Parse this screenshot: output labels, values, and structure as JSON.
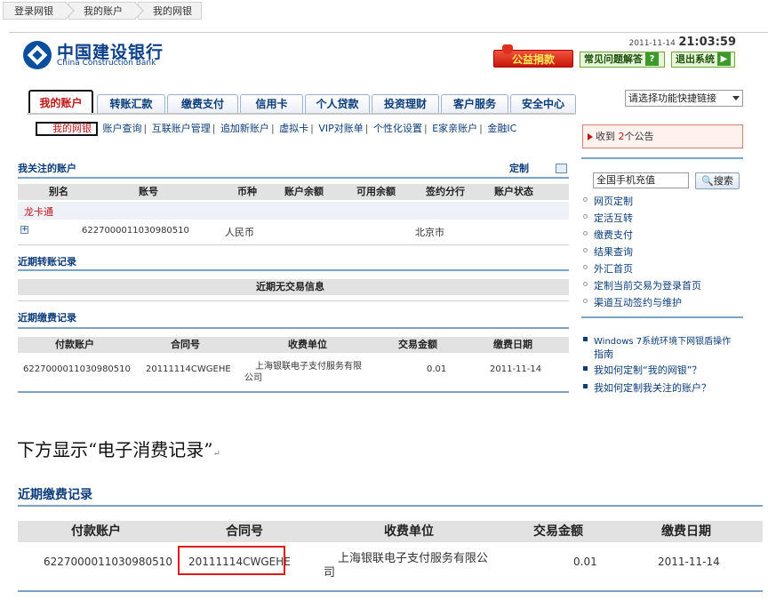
{
  "breadcrumb": [
    "登录网银",
    "我的账户",
    "我的网银"
  ],
  "logo": {
    "cn": "中国建设银行",
    "en": "China Construction Bank"
  },
  "header": {
    "date": "2011-11-14",
    "time": "21:03:59",
    "charity_label": "公益捐款",
    "faq_label": "常见问题解答",
    "faq_icon": "?",
    "logout_label": "退出系统",
    "logout_icon": "▶"
  },
  "tabs": [
    "我的账户",
    "转账汇款",
    "缴费支付",
    "信用卡",
    "个人贷款",
    "投资理财",
    "客户服务",
    "安全中心"
  ],
  "quick_link_select": "请选择功能快捷链接",
  "subnav": [
    "我的网银",
    "账户查询",
    "互联账户管理",
    "追加新账户",
    "虚拟卡",
    "VIP对账单",
    "个性化设置",
    "E家亲账户",
    "金融IC"
  ],
  "notice": {
    "prefix": "收到",
    "count": "2",
    "suffix": "个公告"
  },
  "accounts": {
    "title": "我关注的账户",
    "customize": "定制",
    "headers": [
      "别名",
      "账号",
      "币种",
      "账户余额",
      "可用余额",
      "签约分行",
      "账户状态"
    ],
    "group": "龙卡通",
    "row": {
      "expand": "+",
      "account": "6227000011030980510",
      "currency": "人民币",
      "branch": "北京市"
    }
  },
  "transfers": {
    "title": "近期转账记录",
    "empty": "近期无交易信息"
  },
  "payments": {
    "title": "近期缴费记录",
    "headers": [
      "付款账户",
      "合同号",
      "收费单位",
      "交易金额",
      "缴费日期"
    ],
    "row": {
      "account": "6227000011030980510",
      "contract": "20111114CWGEHE",
      "payee_line1": "上海银联电子支付服务有限",
      "payee_line2": "公司",
      "amount": "0.01",
      "date": "2011-11-14"
    }
  },
  "side": {
    "search_value": "全国手机充值",
    "search_button": "搜索",
    "links": [
      "网页定制",
      "定活互转",
      "缴费支付",
      "结果查询",
      "外汇首页",
      "定制当前交易为登录首页",
      "渠道互动签约与维护"
    ],
    "faq_links": [
      "Windows 7系统环境下网银盾操作",
      "指南",
      "我如何定制“我的网银”？",
      "我如何定制我关注的账户？"
    ]
  },
  "caption": "下方显示“电子消费记录”",
  "caption_mark": "↵",
  "zoom": {
    "title": "近期缴费记录",
    "headers": [
      "付款账户",
      "合同号",
      "收费单位",
      "交易金额",
      "缴费日期"
    ],
    "row": {
      "account": "6227000011030980510",
      "contract": "20111114CWGEHE",
      "payee_line1": "上海银联电子支付服务有限公",
      "payee_line2": "司",
      "amount": "0.01",
      "date": "2011-11-14"
    }
  },
  "colors": {
    "brand_blue": "#0b3d7a",
    "active_red": "#c01414",
    "highlight_red": "#e01a1a"
  }
}
